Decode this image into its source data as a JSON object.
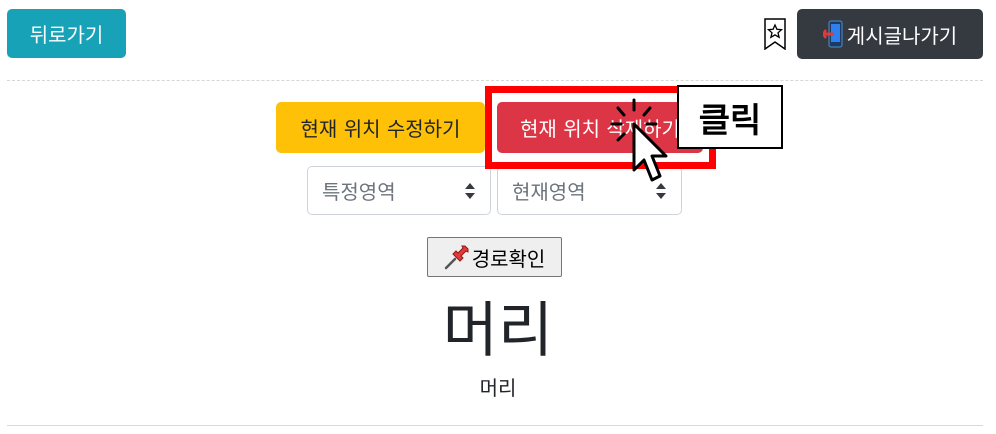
{
  "header": {
    "back_label": "뒤로가기",
    "exit_label": "게시글나가기",
    "exit_icon": "mobile-exit-icon",
    "bookmark_icon": "bookmark-star-icon"
  },
  "actions": {
    "edit_label": "현재 위치 수정하기",
    "delete_label": "현재 위치 삭제하기",
    "edit_color": "#ffc107",
    "delete_color": "#dc3545"
  },
  "selects": {
    "area_value": "특정영역",
    "current_value": "현재영역"
  },
  "route": {
    "label": "경로확인",
    "icon": "pushpin-icon"
  },
  "content": {
    "title": "머리",
    "subtitle": "머리"
  },
  "annotation": {
    "click_label": "클릭",
    "highlight_color": "#ff0000"
  }
}
